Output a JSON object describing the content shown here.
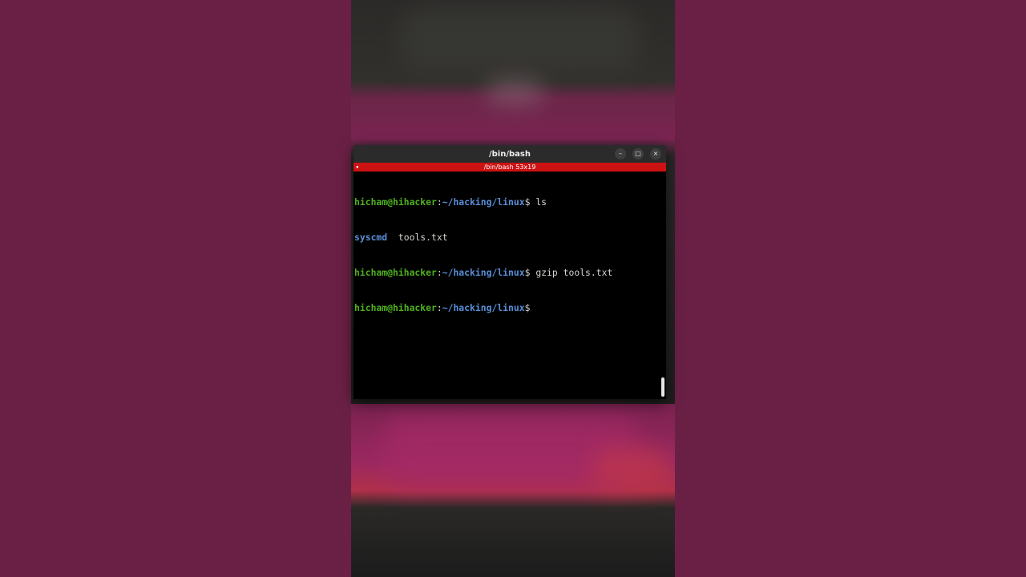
{
  "window": {
    "title": "/bin/bash",
    "minimize_icon": "–",
    "maximize_icon": "□",
    "close_icon": "×"
  },
  "tab": {
    "label": "/bin/bash 53x19",
    "icon_glyph": "▪"
  },
  "terminal": {
    "lines": [
      {
        "user": "hicham@hihacker",
        "sep": ":",
        "path": "~/hacking/linux",
        "prompt": "$ ",
        "command": "ls"
      },
      {
        "output_dir": "syscmd",
        "output_rest": "  tools.txt"
      },
      {
        "user": "hicham@hihacker",
        "sep": ":",
        "path": "~/hacking/linux",
        "prompt": "$ ",
        "command": "gzip tools.txt"
      },
      {
        "user": "hicham@hihacker",
        "sep": ":",
        "path": "~/hacking/linux",
        "prompt": "$",
        "command": ""
      }
    ]
  },
  "colors": {
    "desktop_bg": "#6a2045",
    "tab_bar": "#cc1212",
    "prompt_user": "#4eb11e",
    "prompt_path": "#5a8fd8"
  }
}
